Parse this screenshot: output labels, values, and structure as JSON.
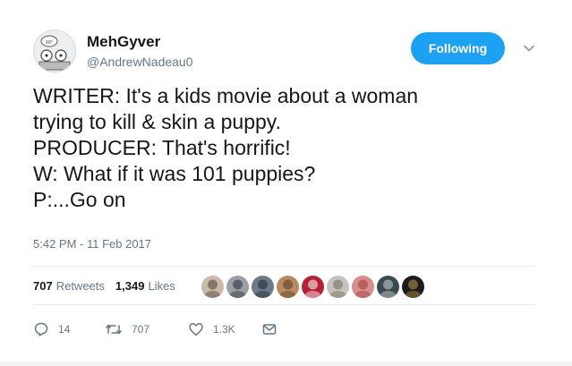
{
  "user": {
    "display_name": "MehGyver",
    "handle": "@AndrewNadeau0"
  },
  "follow_button": {
    "label": "Following"
  },
  "tweet": {
    "lines": [
      "WRITER: It's a kids movie about a woman",
      "trying to kill & skin a puppy.",
      "PRODUCER: That's horrific!",
      "W: What if it was 101 puppies?",
      "P:...Go on"
    ],
    "timestamp": "5:42 PM - 11 Feb 2017"
  },
  "stats": {
    "retweets_count": "707",
    "retweets_label": "Retweets",
    "likes_count": "1,349",
    "likes_label": "Likes"
  },
  "likers": [
    {
      "bg": "#c9b9a8",
      "fg": "#4a3f36"
    },
    {
      "bg": "#9aa0a6",
      "fg": "#2b2f33"
    },
    {
      "bg": "#6c7a89",
      "fg": "#1f262e"
    },
    {
      "bg": "#b88a5f",
      "fg": "#5a3b22"
    },
    {
      "bg": "#b22234",
      "fg": "#ffffff"
    },
    {
      "bg": "#c7c3bb",
      "fg": "#6d6861"
    },
    {
      "bg": "#d98c8c",
      "fg": "#9e3b3b"
    },
    {
      "bg": "#3b4a4f",
      "fg": "#d0d6d8"
    },
    {
      "bg": "#1c1c1c",
      "fg": "#b89a4a"
    }
  ],
  "actions": {
    "reply_count": "14",
    "retweet_count": "707",
    "like_count": "1.3K"
  },
  "colors": {
    "accent": "#1da1f2",
    "secondary_text": "#657786",
    "divider": "#e6ecf0"
  }
}
